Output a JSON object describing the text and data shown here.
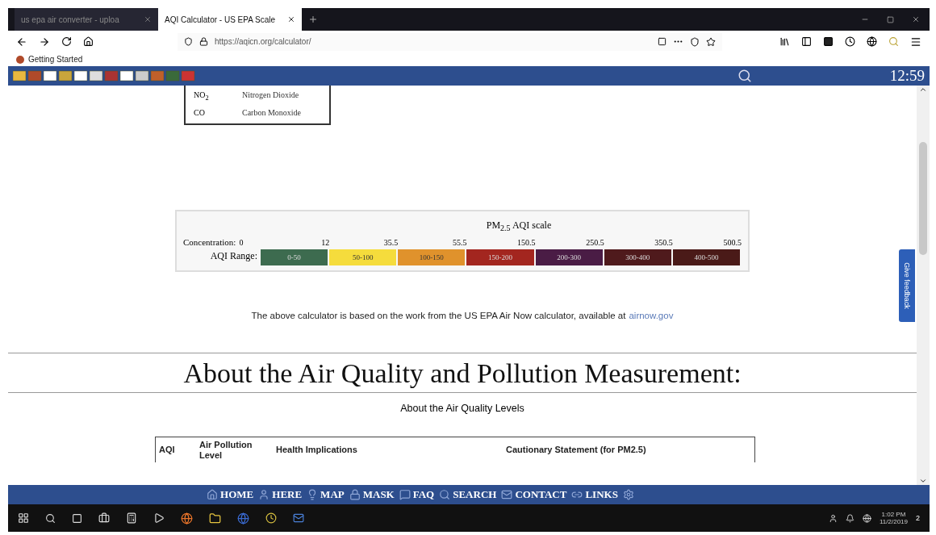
{
  "browser": {
    "tabs": [
      {
        "title": "us epa air converter - uploa",
        "selected": false
      },
      {
        "title": "AQI Calculator - US EPA Scale",
        "selected": true
      }
    ],
    "url": "https://aqicn.org/calculator/",
    "bookmarks": [
      "Getting Started"
    ]
  },
  "site_bar": {
    "clock": "12:59"
  },
  "pollutants": [
    {
      "code": "NO$_{2}$",
      "name": "Nitrogen Dioxide"
    },
    {
      "code": "CO",
      "name": "Carbon Monoxide"
    }
  ],
  "scale": {
    "title": "PM$_{2.5}$ AQI scale",
    "concentration_label": "Concentration:",
    "range_label": "AQI Range:",
    "ticks": [
      "0",
      "12",
      "35.5",
      "55.5",
      "150.5",
      "250.5",
      "350.5",
      "500.5"
    ],
    "ranges": [
      {
        "label": "0-50",
        "color": "#3d6b4f"
      },
      {
        "label": "50-100",
        "color": "#f5dc3c"
      },
      {
        "label": "100-150",
        "color": "#e0922c"
      },
      {
        "label": "150-200",
        "color": "#a3261f"
      },
      {
        "label": "200-300",
        "color": "#4a1c45"
      },
      {
        "label": "300-400",
        "color": "#4f1a1c"
      },
      {
        "label": "400-500",
        "color": "#4a1a18"
      }
    ]
  },
  "note": {
    "text": "The above calculator is based on the work from the US EPA Air Now calculator, available at",
    "link": "airnow.gov"
  },
  "heading": "About the Air Quality and Pollution Measurement:",
  "subheading": "About the Air Quality Levels",
  "levels_table": {
    "columns": [
      "AQI",
      "Air Pollution Level",
      "Health Implications",
      "Cautionary Statement (for PM2.5)"
    ]
  },
  "feedback_tab": "Give feedback",
  "bottom_nav": [
    "HOME",
    "HERE",
    "MAP",
    "MASK",
    "FAQ",
    "SEARCH",
    "CONTACT",
    "LINKS"
  ],
  "taskbar": {
    "time": "1:02 PM",
    "date": "11/2/2019",
    "notifications": "2"
  }
}
